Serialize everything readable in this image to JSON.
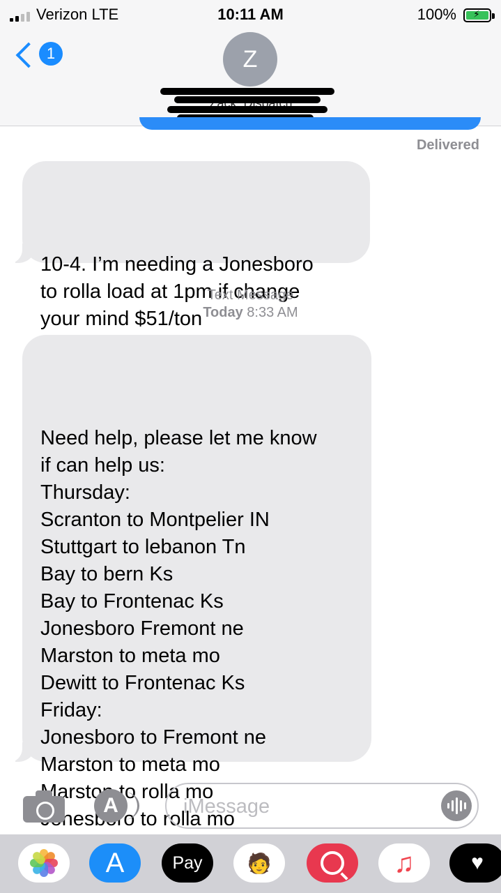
{
  "status_bar": {
    "carrier": "Verizon  LTE",
    "time": "10:11 AM",
    "battery": "100%",
    "signal_bars": 2
  },
  "header": {
    "back_count": "1",
    "avatar_initial": "Z",
    "contact_name": "Zack. Dispatch"
  },
  "thread": {
    "delivered_label": "Delivered",
    "message1": "10-4. I’m needing a Jonesboro\nto rolla load at 1pm if change\nyour mind $51/ton",
    "timestamp_service": "Text Message",
    "timestamp_day": "Today",
    "timestamp_time": "8:33 AM",
    "message2": "Need help, please let me know\nif can help us:\nThursday:\nScranton to Montpelier IN\nStuttgart to lebanon Tn\nBay to bern Ks\nBay to Frontenac Ks\nJonesboro Fremont ne\nMarston to meta mo\nDewitt to Frontenac Ks\nFriday:\nJonesboro to Fremont ne\nMarston to meta mo\nMarston to rolla mo\nJonesboro to rolla mo"
  },
  "composer": {
    "placeholder": "iMessage"
  },
  "app_drawer": {
    "apple_pay_label": "Pay"
  },
  "colors": {
    "accent_blue": "#1a8cff",
    "incoming_bubble": "#e9e9eb",
    "sent_bubble": "#2b8cf8",
    "secondary_text": "#8e8e93"
  }
}
